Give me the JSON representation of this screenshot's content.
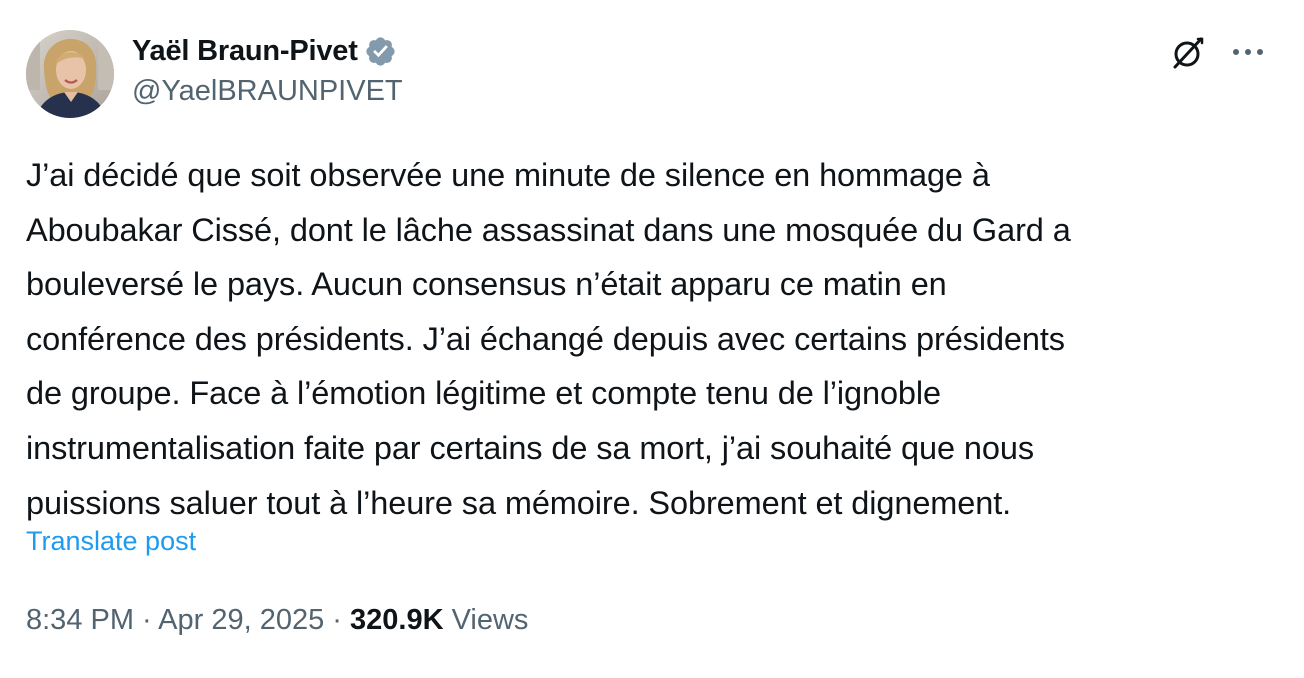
{
  "author": {
    "display_name": "Yaël Braun-Pivet",
    "handle": "@YaelBRAUNPIVET",
    "verified": true,
    "verified_color": "#829aab"
  },
  "header_actions": {
    "grok_icon": "grok-icon",
    "more_icon": "more-horizontal-icon"
  },
  "post": {
    "text": "J’ai décidé que soit observée une minute de silence en hommage à\nAboubakar Cissé, dont le lâche assassinat dans une mosquée du Gard a\nbouleversé le pays. Aucun consensus n’était apparu ce matin en\nconférence des présidents. J’ai échangé depuis avec certains présidents\nde groupe. Face à l’émotion légitime et compte tenu de l’ignoble\ninstrumentalisation faite par certains de sa mort, j’ai souhaité que nous\npuissions saluer tout à l’heure sa mémoire. Sobrement et dignement.",
    "translate_label": "Translate post"
  },
  "meta": {
    "time": "8:34 PM",
    "separator": " · ",
    "date": "Apr 29, 2025",
    "views_count": "320.9K",
    "views_label": " Views"
  },
  "colors": {
    "text_primary": "#0f1419",
    "text_secondary": "#536471",
    "link": "#1d9bf0"
  }
}
